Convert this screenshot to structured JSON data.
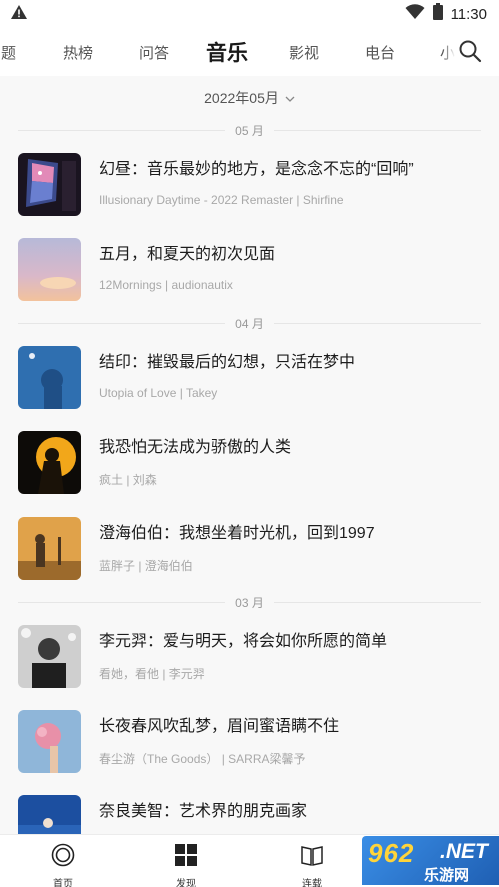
{
  "status_bar": {
    "time": "11:30",
    "icons": [
      "warning-icon",
      "wifi-icon",
      "battery-icon"
    ]
  },
  "tabs": [
    {
      "label": "专题",
      "shown": "专题",
      "active": false
    },
    {
      "label": "热榜",
      "active": false
    },
    {
      "label": "问答",
      "active": false
    },
    {
      "label": "音乐",
      "active": true
    },
    {
      "label": "影视",
      "active": false
    },
    {
      "label": "电台",
      "active": false
    },
    {
      "label": "小",
      "active": false
    }
  ],
  "search_icon": "search-icon",
  "month_picker": {
    "label": "2022年05月",
    "icon": "chevron-down-icon"
  },
  "sections": [
    {
      "month": "05 月",
      "items": [
        {
          "title": "幻昼：音乐最妙的地方，是念念不忘的“回响”",
          "subtitle": "Illusionary Daytime - 2022 Remaster | Shirfine"
        },
        {
          "title": "五月，和夏天的初次见面",
          "subtitle": "12Mornings | audionautix"
        }
      ]
    },
    {
      "month": "04 月",
      "items": [
        {
          "title": "结印：摧毁最后的幻想，只活在梦中",
          "subtitle": "Utopia of Love | Takey"
        },
        {
          "title": "我恐怕无法成为骄傲的人类",
          "subtitle": "疯土 | 刘森"
        },
        {
          "title": "澄海伯伯：我想坐着时光机，回到1997",
          "subtitle": "蓝胖子 | 澄海伯伯"
        }
      ]
    },
    {
      "month": "03 月",
      "items": [
        {
          "title": "李元羿：爱与明天，将会如你所愿的简单",
          "subtitle": "看她，看他 | 李元羿"
        },
        {
          "title": "长夜春风吹乱梦，眉间蜜语瞒不住",
          "subtitle": "春尘游（The Goods） | SARRA梁馨予"
        },
        {
          "title": "奈良美智：艺术界的朋克画家",
          "subtitle": ""
        }
      ]
    }
  ],
  "bottom_nav": [
    {
      "label": "首页",
      "icon": "home-icon"
    },
    {
      "label": "发现",
      "icon": "grid-icon"
    },
    {
      "label": "连载",
      "icon": "book-icon"
    }
  ],
  "watermark": {
    "number": "962",
    "suffix": ".NET",
    "cn": "乐游网"
  },
  "colors": {
    "background": "#f8f8f8",
    "text_primary": "#1c1c1c",
    "text_secondary": "#a8a8a8",
    "divider": "#e6e6e6"
  }
}
